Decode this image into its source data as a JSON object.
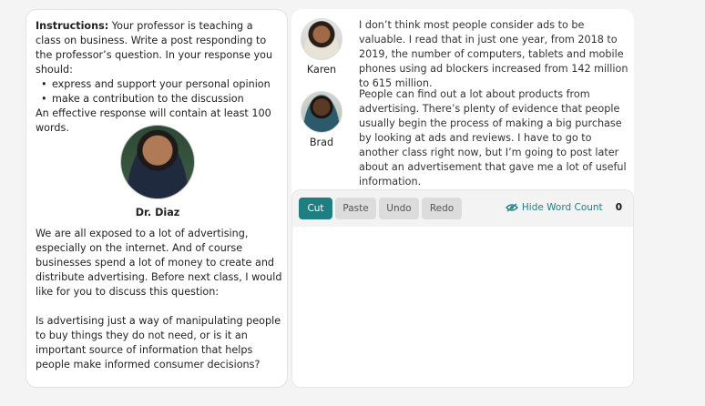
{
  "instructions": {
    "label": "Instructions:",
    "text": " Your professor is teaching a class on business. Write a post responding to the professor’s question. In your response you should:",
    "bullets": [
      "express and support your personal opinion",
      "make a contribution to the discussion"
    ],
    "footer": "An effective response will contain at least 100 words."
  },
  "professor": {
    "name": "Dr. Diaz",
    "paragraph1": "We are all exposed to a lot of advertising, especially on the internet. And of course businesses spend a lot of money to create and distribute advertising. Before next class, I would like for you to discuss this question:",
    "paragraph2": "Is advertising just a way of manipulating people to buy things they do not need, or is it an important source of information that helps people make informed consumer decisions?"
  },
  "posts": [
    {
      "name": "Karen",
      "text": "I don’t think most people consider ads to be valuable. I read that in just one year, from 2018 to 2019, the number of computers, tablets and mobile phones using ad blockers increased from 142 million to 615 million."
    },
    {
      "name": "Brad",
      "text": "People can find out a lot about products from advertising. There’s plenty of evidence that people usually begin the process of making a big purchase by looking at ads and reviews. I have to go to another class right now, but I’m going to post later about an advertisement that gave me a lot of useful information."
    }
  ],
  "toolbar": {
    "cut": "Cut",
    "paste": "Paste",
    "undo": "Undo",
    "redo": "Redo",
    "hide_word_count": "Hide Word Count",
    "word_count": "0"
  },
  "editor": {
    "value": ""
  },
  "colors": {
    "accent": "#1f7e82"
  },
  "icons": {
    "word_count_toggle": "eye-slash-icon"
  }
}
